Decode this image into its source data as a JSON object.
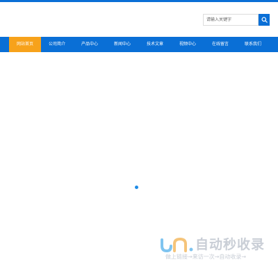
{
  "search": {
    "placeholder": "请输入关键字",
    "button_icon": "search-icon"
  },
  "nav": {
    "items": [
      {
        "label": "网站首页",
        "active": true
      },
      {
        "label": "公司简介",
        "active": false
      },
      {
        "label": "产品中心",
        "active": false
      },
      {
        "label": "新闻中心",
        "active": false
      },
      {
        "label": "技术文章",
        "active": false
      },
      {
        "label": "视频中心",
        "active": false
      },
      {
        "label": "在线留言",
        "active": false
      },
      {
        "label": "联系我们",
        "active": false
      }
    ]
  },
  "watermark": {
    "title": "自动秒收录",
    "subtitle": "做上链接→来访一次→自动收录→"
  },
  "colors": {
    "primary": "#0a6fd6",
    "active_tab": "#f7a21b",
    "loader": "#1e8be6",
    "watermark": "#c9ced6"
  }
}
